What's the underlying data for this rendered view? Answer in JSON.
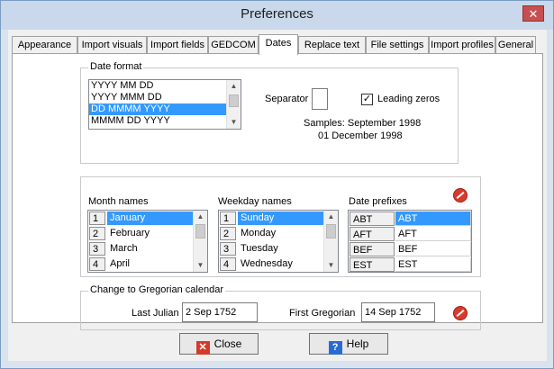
{
  "window": {
    "title": "Preferences",
    "close_glyph": "✕"
  },
  "tabs": [
    {
      "label": "Appearance"
    },
    {
      "label": "Import visuals"
    },
    {
      "label": "Import fields"
    },
    {
      "label": "GEDCOM"
    },
    {
      "label": "Dates",
      "active": true
    },
    {
      "label": "Replace text"
    },
    {
      "label": "File settings"
    },
    {
      "label": "Import profiles"
    },
    {
      "label": "General"
    }
  ],
  "date_format": {
    "group_label": "Date format",
    "options": [
      "YYYY MM DD",
      "YYYY MMM DD",
      "DD MMMM YYYY",
      "MMMM DD YYYY"
    ],
    "selected": "DD MMMM YYYY",
    "separator_label": "Separator",
    "separator_value": "",
    "leading_zeros_label": "Leading zeros",
    "leading_zeros_checked": true,
    "checkbox_glyph": "✓",
    "samples_line1": "Samples: September 1998",
    "samples_line2": "01 December 1998"
  },
  "names": {
    "month_header": "Month names",
    "weekday_header": "Weekday names",
    "prefix_header": "Date prefixes",
    "months": [
      {
        "n": "1",
        "name": "January"
      },
      {
        "n": "2",
        "name": "February"
      },
      {
        "n": "3",
        "name": "March"
      },
      {
        "n": "4",
        "name": "April"
      }
    ],
    "weekdays": [
      {
        "n": "1",
        "name": "Sunday"
      },
      {
        "n": "2",
        "name": "Monday"
      },
      {
        "n": "3",
        "name": "Tuesday"
      },
      {
        "n": "4",
        "name": "Wednesday"
      }
    ],
    "prefixes": [
      {
        "key": "ABT",
        "value": "ABT"
      },
      {
        "key": "AFT",
        "value": "AFT"
      },
      {
        "key": "BEF",
        "value": "BEF"
      },
      {
        "key": "EST",
        "value": "EST"
      }
    ]
  },
  "gregorian": {
    "group_label": "Change to Gregorian calendar",
    "last_julian_label": "Last Julian",
    "last_julian_value": "2 Sep 1752",
    "first_gregorian_label": "First Gregorian",
    "first_gregorian_value": "14 Sep 1752"
  },
  "buttons": {
    "close": "Close",
    "help": "Help",
    "close_glyph": "✕",
    "help_glyph": "?"
  },
  "scroll_glyphs": {
    "up": "▲",
    "down": "▼"
  }
}
